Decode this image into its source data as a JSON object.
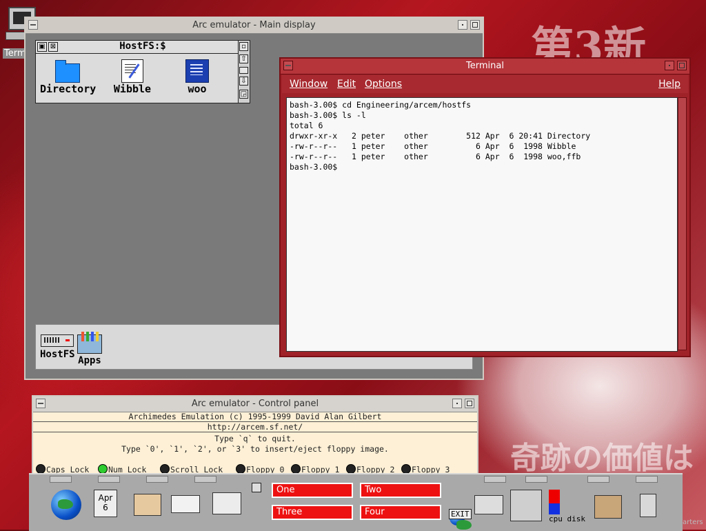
{
  "desktop": {
    "terminal_icon_label": "Term",
    "kanji_top": "第3新",
    "kanji_bottom": "の価値は",
    "kanji_mid": "奇跡",
    "corner_text": "arters"
  },
  "main_window": {
    "title": "Arc emulator - Main display",
    "filer": {
      "title": "HostFS:$",
      "items": [
        {
          "label": "Directory"
        },
        {
          "label": "Wibble"
        },
        {
          "label": "woo"
        }
      ]
    },
    "iconbar": {
      "items": [
        {
          "label": "HostFS"
        },
        {
          "label": "Apps"
        }
      ]
    }
  },
  "terminal": {
    "title": "Terminal",
    "menu": [
      "Window",
      "Edit",
      "Options"
    ],
    "help": "Help",
    "lines": [
      "bash-3.00$ cd Engineering/arcem/hostfs",
      "bash-3.00$ ls -l",
      "total 6",
      "drwxr-xr-x   2 peter    other        512 Apr  6 20:41 Directory",
      "-rw-r--r--   1 peter    other          6 Apr  6  1998 Wibble",
      "-rw-r--r--   1 peter    other          6 Apr  6  1998 woo,ffb",
      "bash-3.00$"
    ]
  },
  "control_panel": {
    "title": "Arc emulator - Control panel",
    "copyright": "Archimedes Emulation (c) 1995-1999 David Alan Gilbert",
    "url": "http://arcem.sf.net/",
    "instr1": "Type `q` to quit.",
    "instr2": "Type `0', `1', `2', or `3' to insert/eject floppy image.",
    "leds": [
      {
        "label": "Caps Lock",
        "on": false
      },
      {
        "label": "Num Lock",
        "on": true
      },
      {
        "label": "Scroll Lock",
        "on": false
      },
      {
        "label": "Floppy 0",
        "on": false
      },
      {
        "label": "Floppy 1",
        "on": false
      },
      {
        "label": "Floppy 2",
        "on": false
      },
      {
        "label": "Floppy 3",
        "on": false
      }
    ]
  },
  "dock": {
    "calendar": {
      "month": "Apr",
      "day": "6"
    },
    "pager": [
      "One",
      "Two",
      "Three",
      "Four"
    ],
    "exit_label": "EXIT",
    "cpu_disk_label": "cpu disk"
  },
  "colors": {
    "terminal_frame": "#a02229",
    "pager_red": "#ee1111",
    "led_on": "#2ecc2e"
  }
}
